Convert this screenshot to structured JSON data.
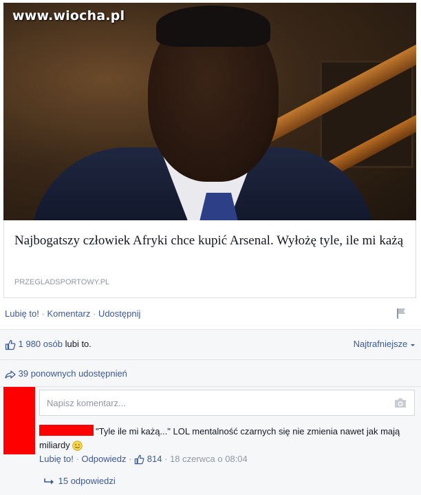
{
  "watermark": "www.wiocha.pl",
  "link": {
    "title": "Najbogatszy człowiek Afryki chce kupić Arsenal. Wyłożę tyle, ile mi każą",
    "source": "PRZEGLADSPORTOWY.PL"
  },
  "actions": {
    "like": "Lubię to!",
    "comment": "Komentarz",
    "share": "Udostępnij",
    "separator": "·"
  },
  "likes": {
    "count": "1 980 osób",
    "suffix": "lubi to.",
    "sort": "Najtrafniejsze"
  },
  "shares": {
    "text": "39 ponownych udostępnień"
  },
  "comment_box": {
    "placeholder": "Napisz komentarz..."
  },
  "comment": {
    "text": "\"Tyle ile mi każą...\" LOL mentalność czarnych się nie zmienia nawet jak mają miliardy",
    "like": "Lubię to!",
    "reply": "Odpowiedz",
    "like_count": "814",
    "timestamp": "18 czerwca o 08:04"
  },
  "replies": {
    "text": "15 odpowiedzi"
  },
  "colors": {
    "link_blue": "#3b5998",
    "redaction": "#ff0000",
    "muted": "#9197a3"
  }
}
